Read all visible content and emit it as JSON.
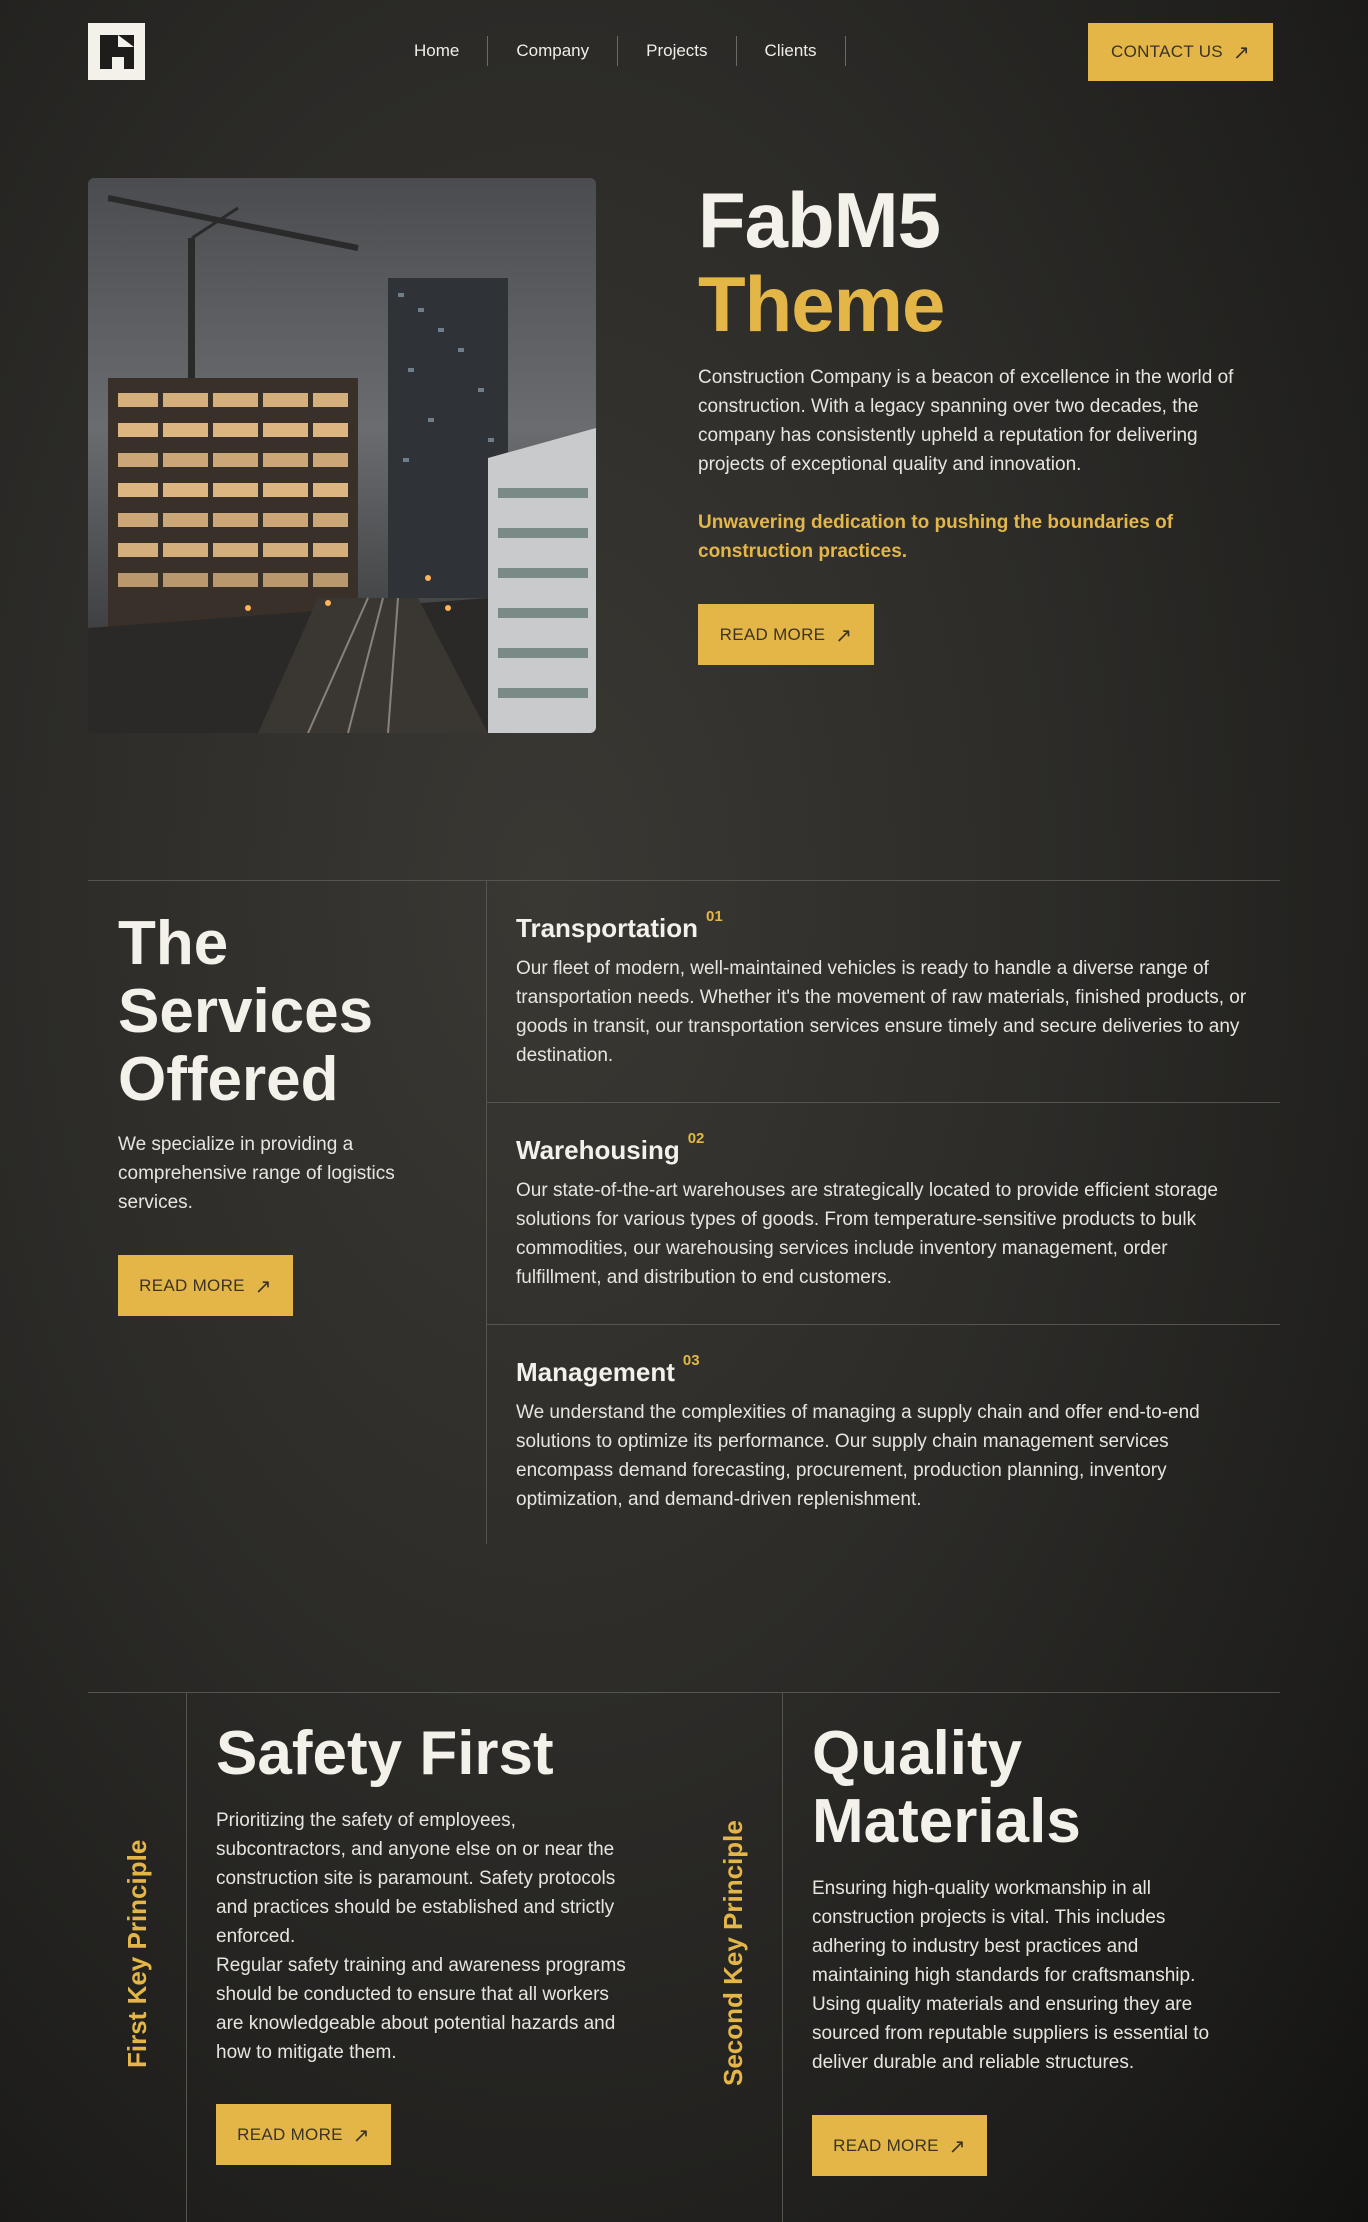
{
  "nav": {
    "items": [
      {
        "label": "Home"
      },
      {
        "label": "Company"
      },
      {
        "label": "Projects"
      },
      {
        "label": "Clients"
      }
    ],
    "contact_label": "CONTACT US"
  },
  "hero": {
    "title_line1": "FabM5",
    "title_line2": "Theme",
    "description": "Construction Company is a beacon of excellence in the world of construction. With a legacy spanning over two decades, the company has consistently upheld a reputation for delivering projects of exceptional quality and innovation.",
    "emphasis": "Unwavering dedication to pushing the boundaries of construction practices.",
    "button_label": "READ MORE"
  },
  "services": {
    "title": "The Services Offered",
    "description": "We specialize in providing a comprehensive range of logistics services.",
    "button_label": "READ MORE",
    "items": [
      {
        "title": "Transportation",
        "number": "01",
        "text": "Our fleet of modern, well-maintained vehicles is ready to handle a diverse range of transportation needs. Whether it's the movement of raw materials, finished products, or goods in transit, our transportation services ensure timely and secure deliveries to any destination."
      },
      {
        "title": "Warehousing",
        "number": "02",
        "text": "Our state-of-the-art warehouses are strategically located to provide efficient storage solutions for various types of goods. From temperature-sensitive products to bulk commodities, our warehousing services include inventory management, order fulfillment, and distribution to end customers."
      },
      {
        "title": "Management",
        "number": "03",
        "text": "We understand the complexities of managing a supply chain and offer end-to-end solutions to optimize its performance. Our supply chain management services encompass demand forecasting, procurement, production planning, inventory optimization, and demand-driven replenishment."
      }
    ]
  },
  "principles": [
    {
      "label": "First Key Principle",
      "title": "Safety First",
      "text_1": "Prioritizing the safety of employees, subcontractors, and anyone else on or near the construction site is paramount. Safety protocols and practices should be established and strictly enforced.",
      "text_2": "Regular safety training and awareness programs should be conducted to ensure that all workers are knowledgeable about potential hazards and how to mitigate them.",
      "button_label": "READ MORE"
    },
    {
      "label": "Second Key Principle",
      "title": "Quality Materials",
      "text_1": "Ensuring high-quality workmanship in all construction projects is vital. This includes adhering to industry best practices and maintaining high standards for craftsmanship. Using quality materials and ensuring they are sourced from reputable suppliers is essential to deliver durable and reliable structures.",
      "button_label": "READ MORE"
    }
  ],
  "icons": {
    "logo": "building-logo-icon",
    "button_arrow": "arrow-up-right-icon"
  },
  "colors": {
    "accent": "#e4b647",
    "background": "#2c2b28",
    "heading": "#f4f1ea"
  }
}
